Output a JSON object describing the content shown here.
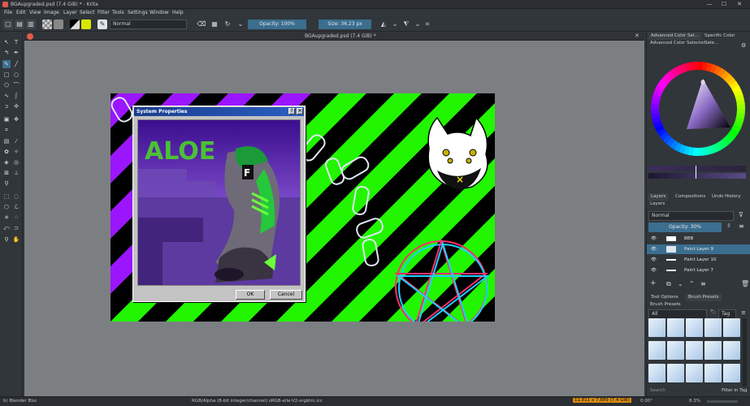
{
  "window": {
    "title": "BGAupgraded.psd (7.4 GiB) * - Krita",
    "minimize": "—",
    "maximize": "☐",
    "close": "✕"
  },
  "menu": [
    "File",
    "Edit",
    "View",
    "Image",
    "Layer",
    "Select",
    "Filter",
    "Tools",
    "Settings",
    "Window",
    "Help"
  ],
  "toolbar": {
    "blend_mode": "Normal",
    "opacity": "Opacity: 100%",
    "size": "Size: 36.23 px"
  },
  "document_tab": {
    "title": "BGAupgraded.psd (7.4 GiB) *"
  },
  "artwork": {
    "graffiti_text": "ALOE",
    "dialog": {
      "title": "System Properties",
      "help_btn": "?",
      "close_btn": "✕",
      "ok": "OK",
      "cancel": "Cancel"
    }
  },
  "right_panel": {
    "top_tabs": [
      "Advanced Color Sel...",
      "Specific Color Sele..."
    ],
    "color_selector_title": "Advanced Color Selector",
    "layer_tabs": [
      "Layers",
      "Compositions",
      "Undo History"
    ],
    "layers_title": "Layers",
    "layers_blend": "Normal",
    "layers_opacity": "Opacity: 30%",
    "layers": [
      {
        "name": "BBB",
        "selected": false
      },
      {
        "name": "Paint Layer 9",
        "selected": true
      },
      {
        "name": "Paint Layer 10",
        "selected": false
      },
      {
        "name": "Paint Layer 7",
        "selected": false
      }
    ],
    "tool_tabs": [
      "Tool Options",
      "Brush Presets"
    ],
    "brush_presets_title": "Brush Presets",
    "brush_filter": "All",
    "brush_tag": "Tag",
    "search_placeholder": "Search",
    "filter_in_tag": "Filter in Tag"
  },
  "status": {
    "brush_name": "b) Blender Blur",
    "color_info": "RGB/Alpha (8-bit integer/channel)  sRGB-elle-V2-srgbtrc.icc",
    "dimensions": "11,811 x 7,889 (7.4 GiB)",
    "rotation": "0.00°",
    "zoom": "8.3%"
  },
  "colors": {
    "purple": "#9b16ff",
    "green": "#22f500",
    "accent": "#3b6e8f"
  }
}
